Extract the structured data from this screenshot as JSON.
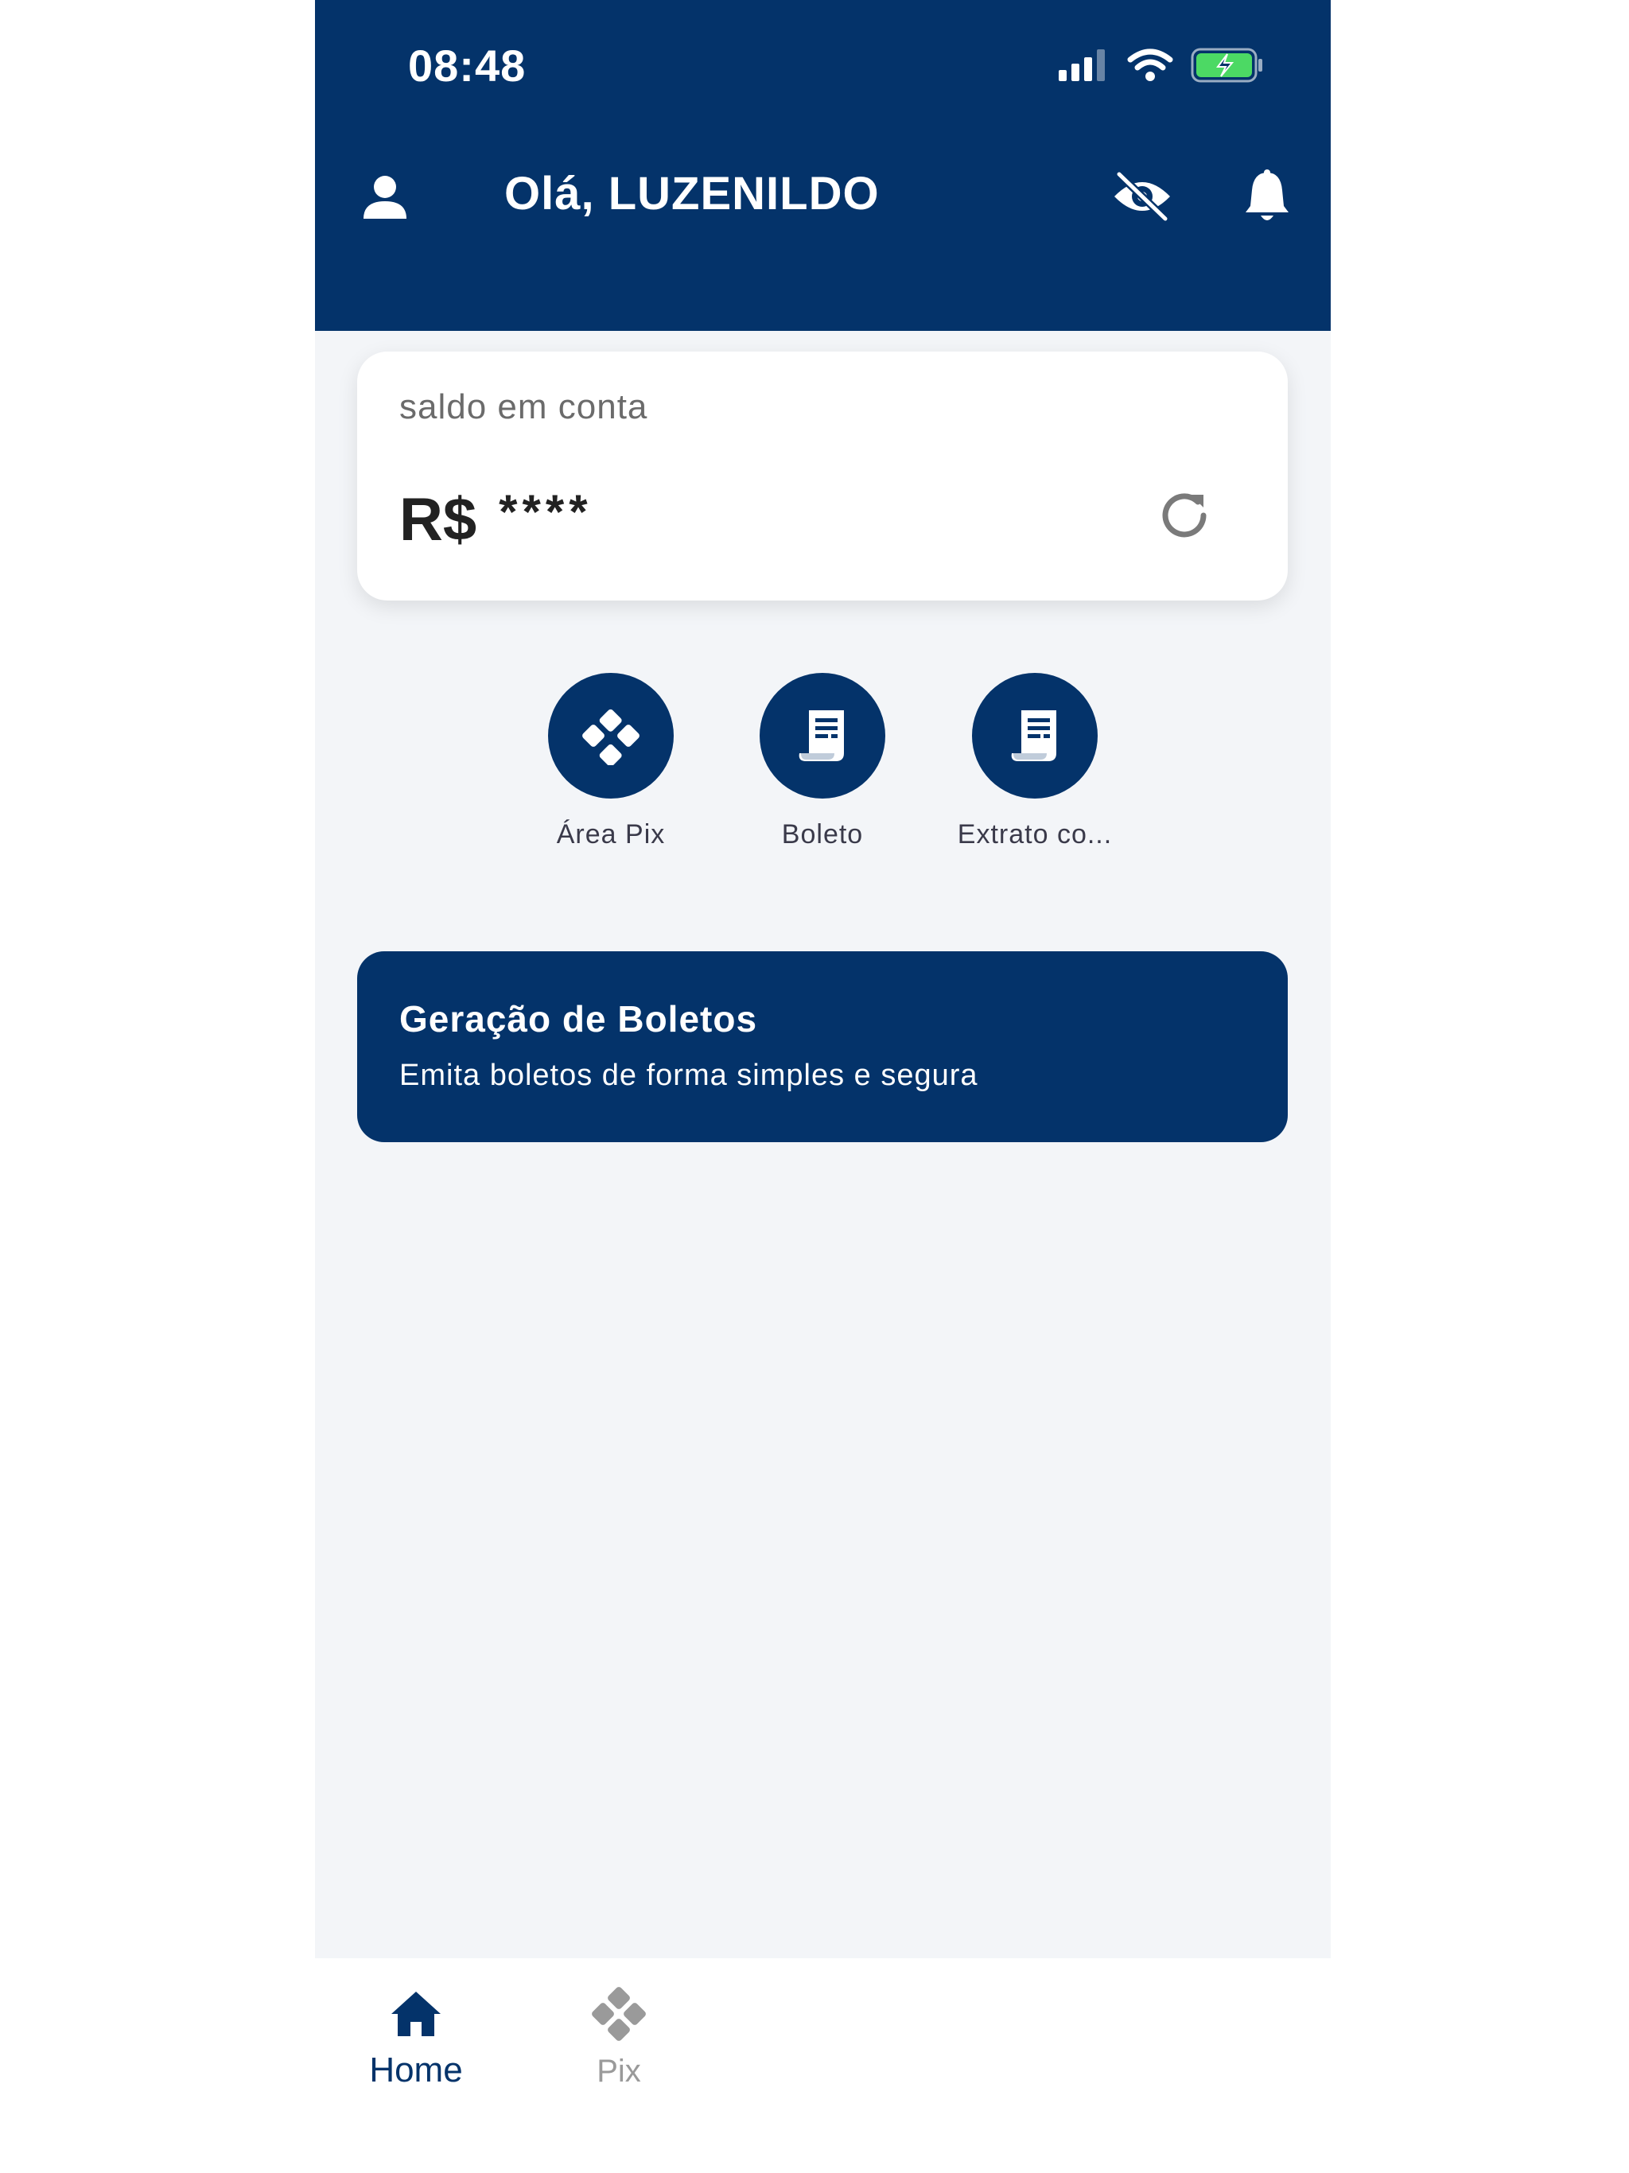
{
  "status_bar": {
    "time": "08:48",
    "icons": [
      "cellular-signal-icon",
      "wifi-icon",
      "battery-charging-icon"
    ]
  },
  "header": {
    "greeting": "Olá, LUZENILDO",
    "icons": [
      "user-icon",
      "eye-off-icon",
      "bell-icon"
    ]
  },
  "balance": {
    "label": "saldo em conta",
    "currency": "R$",
    "masked_value": "****",
    "refresh_icon": "refresh-icon"
  },
  "quick_actions": [
    {
      "label": "Área Pix",
      "icon": "pix-icon"
    },
    {
      "label": "Boleto",
      "icon": "receipt-icon"
    },
    {
      "label": "Extrato co...",
      "icon": "receipt-icon"
    }
  ],
  "banner": {
    "title": "Geração de Boletos",
    "subtitle": "Emita boletos de forma simples e segura"
  },
  "tabbar": {
    "tabs": [
      {
        "label": "Home",
        "icon": "home-icon",
        "active": true
      },
      {
        "label": "Pix",
        "icon": "pix-icon",
        "active": false
      }
    ]
  },
  "colors": {
    "primary": "#04336a",
    "background": "#f3f5f8",
    "battery_green": "#4cd964"
  }
}
